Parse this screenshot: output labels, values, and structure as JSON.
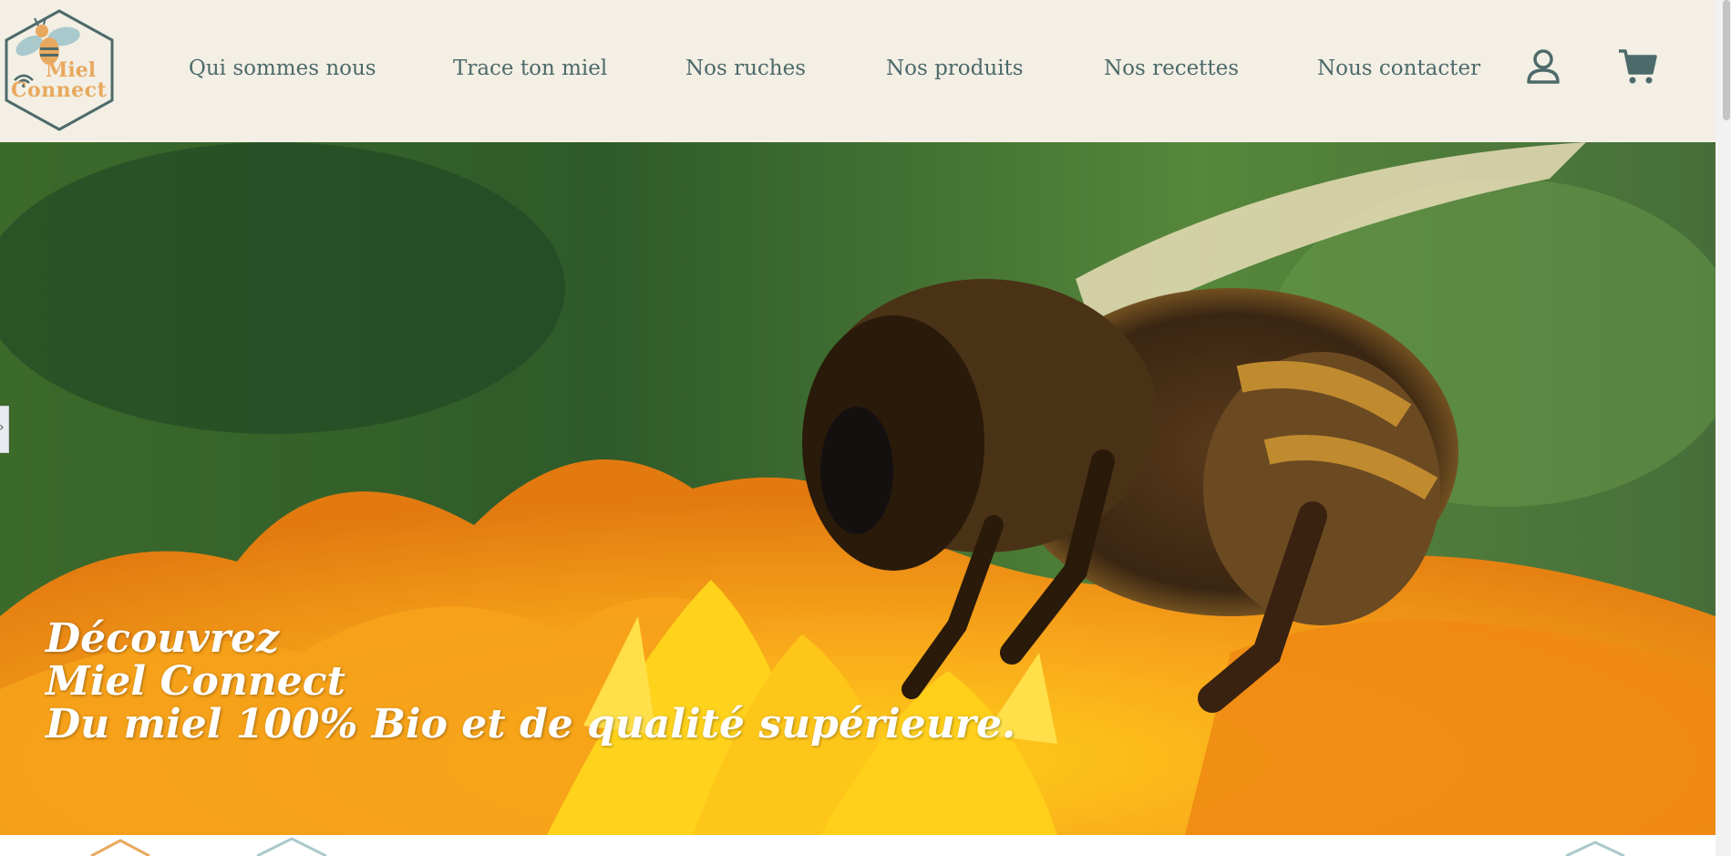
{
  "brand": {
    "logo_line1": "Miel",
    "logo_line2": "Connect",
    "primary_color": "#4d6a6a",
    "accent_color": "#e8a95f",
    "header_bg": "#f3efe4"
  },
  "nav": {
    "items": [
      {
        "label": "Qui sommes nous"
      },
      {
        "label": "Trace ton miel"
      },
      {
        "label": "Nos ruches"
      },
      {
        "label": "Nos produits"
      },
      {
        "label": "Nos recettes"
      },
      {
        "label": "Nous contacter"
      }
    ],
    "icons": [
      "user-icon",
      "cart-icon"
    ]
  },
  "hero": {
    "line1": "Découvrez",
    "line2": "Miel Connect",
    "line3": "Du miel 100% Bio et de qualité supérieure.",
    "image": "bee-on-orange-flower-photo"
  },
  "side_tab": {
    "glyph": "›"
  }
}
